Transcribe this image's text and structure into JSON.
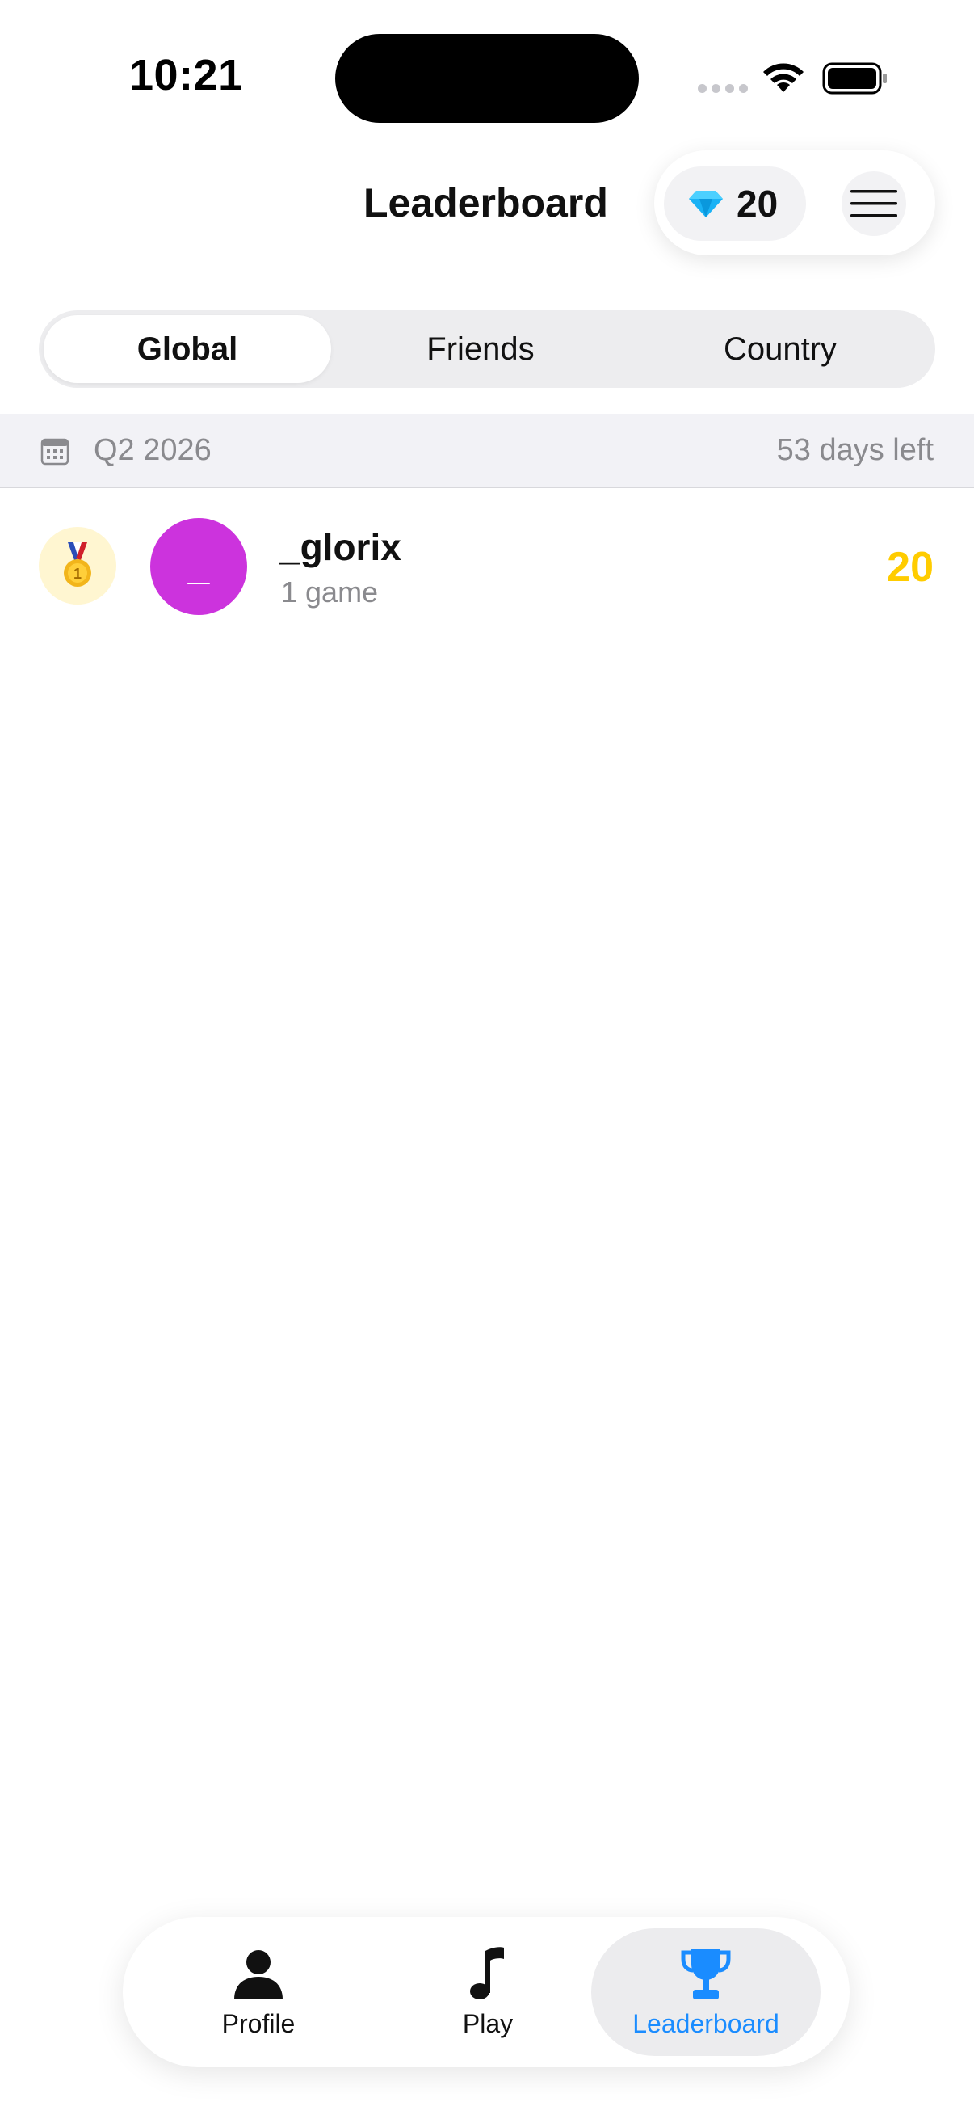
{
  "status_bar": {
    "time": "10:21"
  },
  "header": {
    "title": "Leaderboard",
    "gem_count": "20",
    "icons": {
      "gem": "diamond-icon",
      "menu": "hamburger-menu-icon"
    }
  },
  "segments": {
    "items": [
      {
        "label": "Global",
        "selected": true
      },
      {
        "label": "Friends",
        "selected": false
      },
      {
        "label": "Country",
        "selected": false
      }
    ]
  },
  "season": {
    "label": "Q2 2026",
    "days_left": "53 days left",
    "icon": "calendar-icon"
  },
  "leaderboard": {
    "rows": [
      {
        "rank_icon": "first-place-medal-icon",
        "avatar_text": "_",
        "avatar_color": "#cc33dd",
        "name": "_glorix",
        "games": "1 game",
        "score": "20",
        "score_color": "#ffcc00"
      }
    ]
  },
  "tab_bar": {
    "items": [
      {
        "label": "Profile",
        "icon": "person-icon",
        "selected": false
      },
      {
        "label": "Play",
        "icon": "music-note-icon",
        "selected": false
      },
      {
        "label": "Leaderboard",
        "icon": "trophy-icon",
        "selected": true
      }
    ],
    "accent_color": "#1a8cff"
  }
}
